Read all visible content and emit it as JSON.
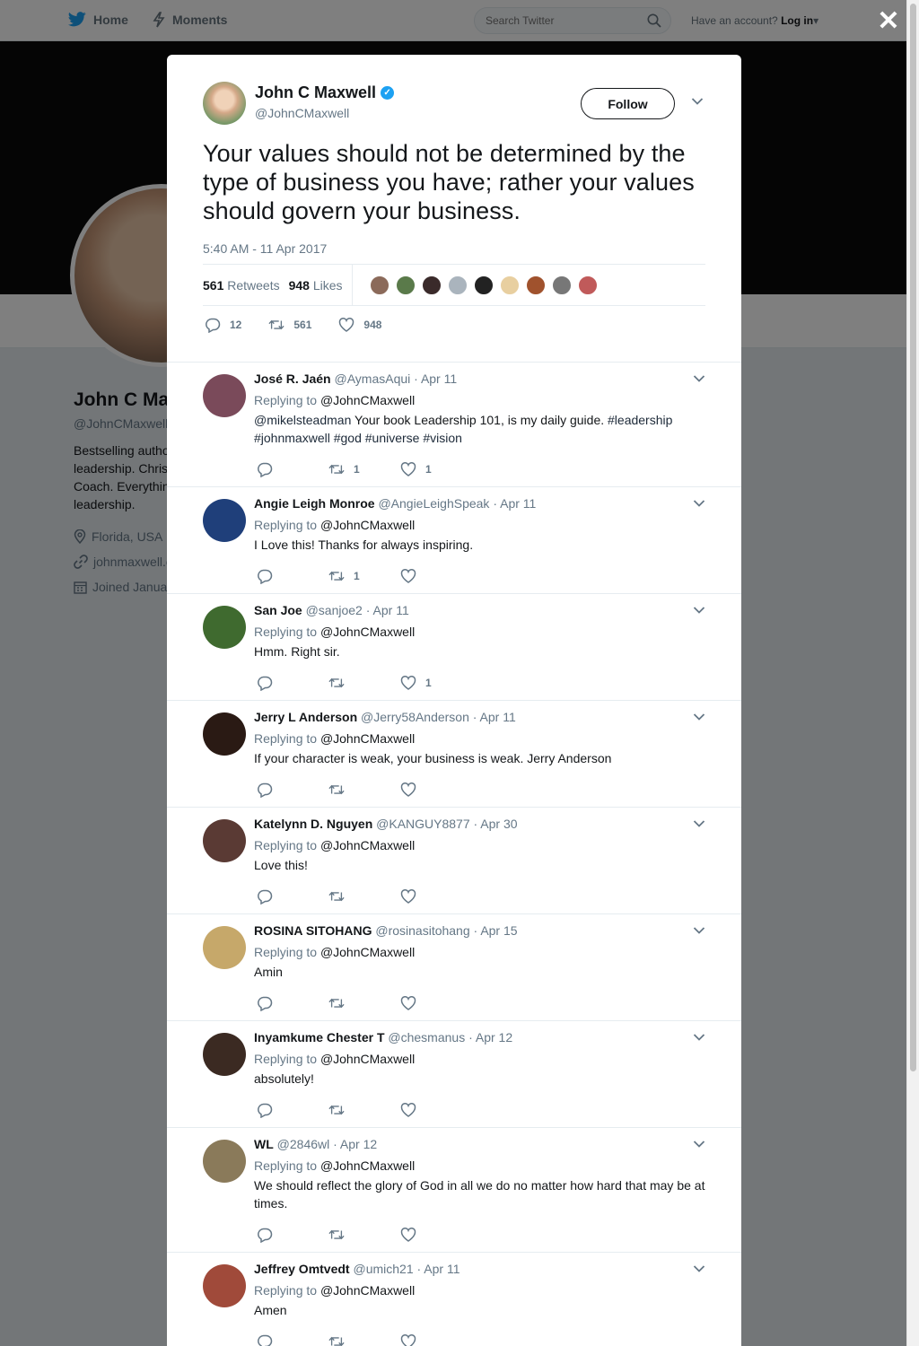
{
  "topbar": {
    "home_label": "Home",
    "moments_label": "Moments",
    "search_placeholder": "Search Twitter",
    "account_prompt": "Have an account?",
    "login_label": "Log in"
  },
  "profile": {
    "name": "John C Maxwell",
    "handle": "@JohnCMaxwell",
    "bio": "Bestselling author\nleadership. Christ\nCoach. Everything\nleadership.",
    "location": "Florida, USA",
    "website": "johnmaxwell.c",
    "joined": "Joined Janua"
  },
  "main_tweet": {
    "author_name": "John C Maxwell",
    "author_handle": "@JohnCMaxwell",
    "follow_label": "Follow",
    "text": "Your values should not be determined by the type of business you have; rather your values should govern your business.",
    "timestamp": "5:40 AM - 11 Apr 2017",
    "retweets_count": "561",
    "retweets_label": "Retweets",
    "likes_count": "948",
    "likes_label": "Likes",
    "reply_count": "12",
    "retweet_count": "561",
    "like_count": "948",
    "liker_colors": [
      "#8b6a5a",
      "#5a7a4a",
      "#3a2a2a",
      "#aab4bd",
      "#222222",
      "#e8cfa0",
      "#a0522d",
      "#777777",
      "#c05a5a"
    ]
  },
  "replies": [
    {
      "name": "José R. Jaén",
      "handle": "@AymasAqui",
      "date": "Apr 11",
      "replying_prefix": "Replying to",
      "replying_to": "@JohnCMaxwell",
      "text_mention": "@mikelsteadman",
      "text": " Your book Leadership 101, is my daily guide. ",
      "hashtags": "#leadership #johnmaxwell #god #universe #vision",
      "retweets": "1",
      "likes": "1",
      "avatar_color": "#7a4a5a"
    },
    {
      "name": "Angie Leigh Monroe",
      "handle": "@AngieLeighSpeak",
      "date": "Apr 11",
      "replying_prefix": "Replying to",
      "replying_to": "@JohnCMaxwell",
      "text": "I Love this! Thanks for always inspiring.",
      "retweets": "1",
      "likes": "",
      "avatar_color": "#1f3f7a"
    },
    {
      "name": "San Joe",
      "handle": "@sanjoe2",
      "date": "Apr 11",
      "replying_prefix": "Replying to",
      "replying_to": "@JohnCMaxwell",
      "text": "Hmm. Right sir.",
      "retweets": "",
      "likes": "1",
      "avatar_color": "#3f6a2f"
    },
    {
      "name": "Jerry L Anderson",
      "handle": "@Jerry58Anderson",
      "date": "Apr 11",
      "replying_prefix": "Replying to",
      "replying_to": "@JohnCMaxwell",
      "text": "If your character is weak, your business is weak. Jerry Anderson",
      "retweets": "",
      "likes": "",
      "avatar_color": "#2a1a14"
    },
    {
      "name": "Katelynn D. Nguyen",
      "handle": "@KANGUY8877",
      "date": "Apr 30",
      "replying_prefix": "Replying to",
      "replying_to": "@JohnCMaxwell",
      "text": "Love this!",
      "retweets": "",
      "likes": "",
      "avatar_color": "#5a3a34"
    },
    {
      "name": "ROSINA SITOHANG",
      "handle": "@rosinasitohang",
      "date": "Apr 15",
      "replying_prefix": "Replying to",
      "replying_to": "@JohnCMaxwell",
      "text": "Amin",
      "retweets": "",
      "likes": "",
      "avatar_color": "#c6a86a"
    },
    {
      "name": "Inyamkume Chester T",
      "handle": "@chesmanus",
      "date": "Apr 12",
      "replying_prefix": "Replying to",
      "replying_to": "@JohnCMaxwell",
      "text": "absolutely!",
      "retweets": "",
      "likes": "",
      "avatar_color": "#3b2a22"
    },
    {
      "name": "WL",
      "handle": "@2846wl",
      "date": "Apr 12",
      "replying_prefix": "Replying to",
      "replying_to": "@JohnCMaxwell",
      "text": "We should reflect the glory of God in all we do no matter how hard that may be at times.",
      "retweets": "",
      "likes": "",
      "avatar_color": "#8a7a5a"
    },
    {
      "name": "Jeffrey Omtvedt",
      "handle": "@umich21",
      "date": "Apr 11",
      "replying_prefix": "Replying to",
      "replying_to": "@JohnCMaxwell",
      "text": "Amen",
      "retweets": "",
      "likes": "",
      "avatar_color": "#a04a3a"
    }
  ],
  "colors": {
    "accent": "#1da1f2",
    "muted": "#657786",
    "overlay": "rgba(0,0,0,0.5)"
  },
  "icons": {
    "reply": "reply-icon",
    "retweet": "retweet-icon",
    "like": "heart-icon",
    "close": "close-icon"
  }
}
